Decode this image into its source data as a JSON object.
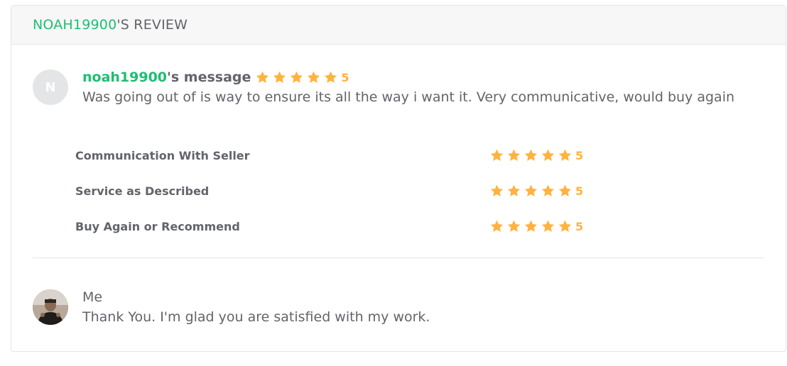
{
  "header": {
    "username": "NOAH19900",
    "suffix": "'S REVIEW"
  },
  "buyer_message": {
    "avatar_initial": "N",
    "username": "noah19900",
    "title_suffix": "'s message",
    "rating": "5",
    "stars": 5,
    "text": "Was going out of is way to ensure its all the way i want it. Very communicative, would buy again"
  },
  "ratings": [
    {
      "label": "Communication With Seller",
      "value": "5",
      "stars": 5
    },
    {
      "label": "Service as Described",
      "value": "5",
      "stars": 5
    },
    {
      "label": "Buy Again or Recommend",
      "value": "5",
      "stars": 5
    }
  ],
  "seller_reply": {
    "name": "Me",
    "text": "Thank You. I'm glad you are satisfied with my work."
  },
  "colors": {
    "accent_green": "#1dbf73",
    "star": "#ffb33e",
    "text": "#62646a"
  }
}
